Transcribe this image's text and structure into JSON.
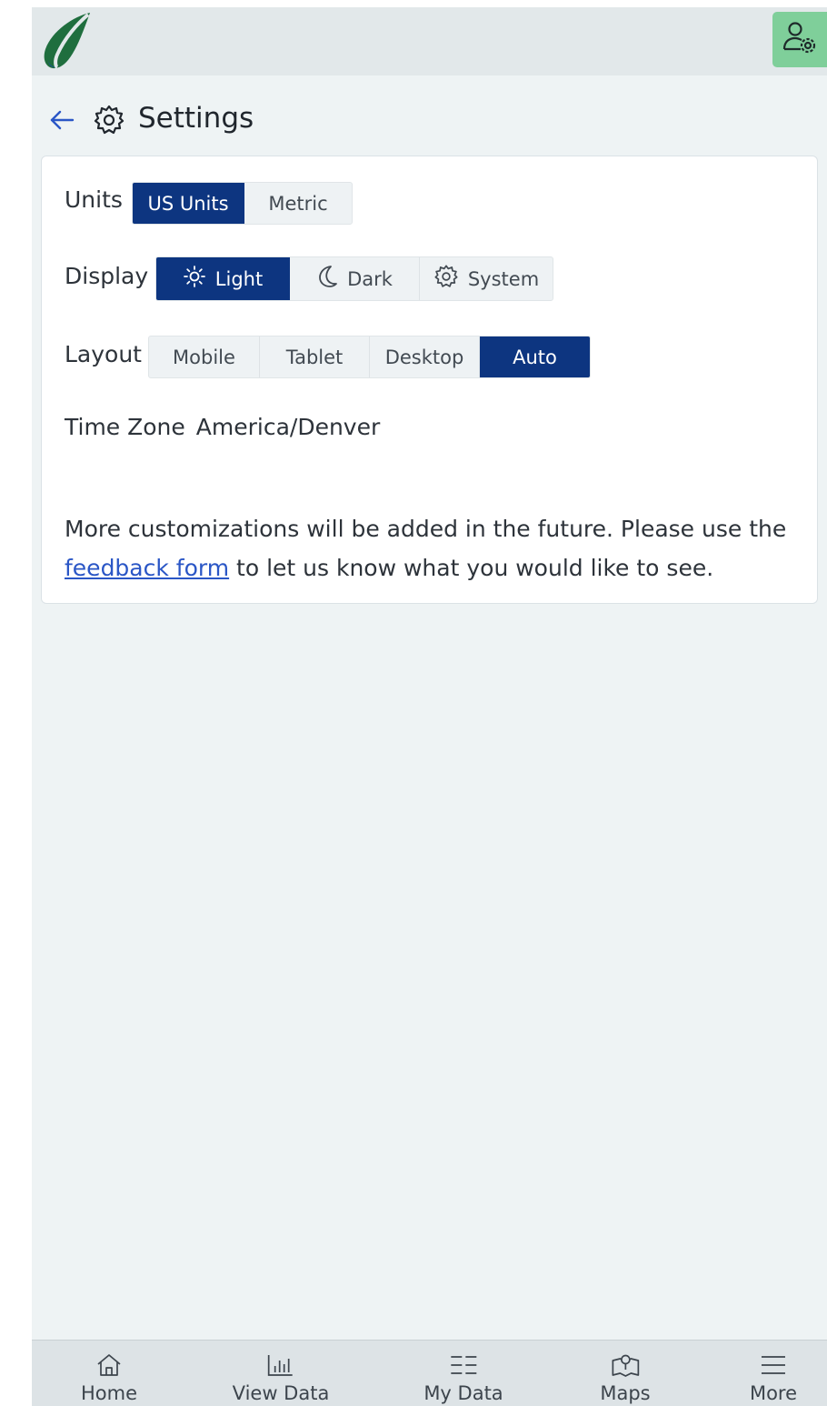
{
  "header": {
    "logo_name": "leaf-logo",
    "account_icon": "account-settings-icon",
    "colors": {
      "topbar": "#e2e8ea",
      "account_button": "#7fcf9a"
    }
  },
  "page": {
    "back_icon": "back-arrow-icon",
    "title_icon": "gear-icon",
    "title": "Settings"
  },
  "settings": {
    "units": {
      "label": "Units",
      "options": [
        "US Units",
        "Metric"
      ],
      "selected": "US Units"
    },
    "display": {
      "label": "Display",
      "options": [
        "Light",
        "Dark",
        "System"
      ],
      "option_icons": [
        "sun-icon",
        "moon-icon",
        "gear-icon"
      ],
      "selected": "Light"
    },
    "layout": {
      "label": "Layout",
      "options": [
        "Mobile",
        "Tablet",
        "Desktop",
        "Auto"
      ],
      "selected": "Auto"
    },
    "timezone": {
      "label": "Time Zone",
      "value": "America/Denver"
    },
    "note": {
      "before": "More customizations will be added in the future. Please use the ",
      "link": "feedback form",
      "after": " to let us know what you would like to see."
    },
    "accent_color": "#0d3580"
  },
  "nav": {
    "items": [
      {
        "label": "Home",
        "icon": "home-icon"
      },
      {
        "label": "View Data",
        "icon": "bar-chart-icon"
      },
      {
        "label": "My Data",
        "icon": "list-icon"
      },
      {
        "label": "Maps",
        "icon": "map-icon"
      },
      {
        "label": "More",
        "icon": "menu-icon"
      }
    ]
  }
}
